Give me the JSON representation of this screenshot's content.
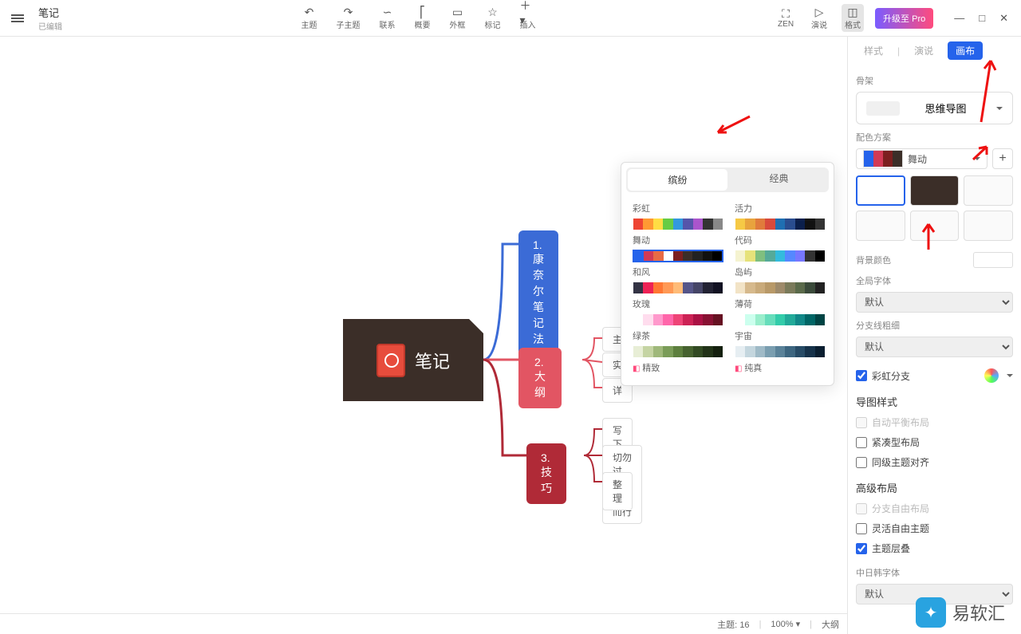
{
  "header": {
    "title": "笔记",
    "subtitle": "已编辑",
    "toolbar": [
      {
        "label": "主题",
        "icon": "↶"
      },
      {
        "label": "子主题",
        "icon": "↷"
      },
      {
        "label": "联系",
        "icon": "∽"
      },
      {
        "label": "概要",
        "icon": "⎡"
      },
      {
        "label": "外框",
        "icon": "▭"
      },
      {
        "label": "标记",
        "icon": "☆"
      },
      {
        "label": "插入",
        "icon": "＋"
      }
    ],
    "right_tools": [
      {
        "label": "ZEN",
        "icon": "⛶"
      },
      {
        "label": "演说",
        "icon": "▷"
      },
      {
        "label": "格式",
        "icon": "◫",
        "active": true
      }
    ],
    "pro_button": "升级至 Pro"
  },
  "mindmap": {
    "central": "笔记",
    "branches": [
      {
        "label": "1. 康奈尔笔记法",
        "children": []
      },
      {
        "label": "2. 大纲",
        "children": [
          "主",
          "实",
          "详"
        ]
      },
      {
        "label": "3. 技巧",
        "children": [
          "写下关键事实",
          "切勿过度，量力而行",
          "整理"
        ]
      }
    ]
  },
  "theme_popup": {
    "tabs": [
      "缤纷",
      "经典"
    ],
    "active_tab": 0,
    "schemes": [
      {
        "name": "彩虹",
        "colors": [
          "#e43",
          "#f93",
          "#fd4",
          "#6c4",
          "#39d",
          "#55a",
          "#a5c",
          "#333",
          "#888"
        ]
      },
      {
        "name": "活力",
        "colors": [
          "#f6c945",
          "#e8a33d",
          "#e07b3c",
          "#d84a3c",
          "#1f6fb2",
          "#2a4d8f",
          "#0b1f4b",
          "#111",
          "#333"
        ]
      },
      {
        "name": "舞动",
        "colors": [
          "#2563eb",
          "#d23a55",
          "#e86b45",
          "#fff",
          "#7c1f1f",
          "#3b2e28",
          "#222",
          "#111",
          "#000"
        ],
        "selected": true
      },
      {
        "name": "代码",
        "colors": [
          "#f5f3d0",
          "#e6e27a",
          "#7fbf7f",
          "#5a9",
          "#3bd",
          "#58f",
          "#77f",
          "#333",
          "#000"
        ]
      },
      {
        "name": "和风",
        "colors": [
          "#334",
          "#e25",
          "#f73",
          "#f95",
          "#fb7",
          "#558",
          "#446",
          "#223",
          "#112"
        ]
      },
      {
        "name": "岛屿",
        "colors": [
          "#f2e3c6",
          "#d6b98c",
          "#c9aa7a",
          "#b89968",
          "#9e8a6a",
          "#7a7a5a",
          "#5a6a4a",
          "#3a4a3a",
          "#222"
        ]
      },
      {
        "name": "玫瑰",
        "colors": [
          "#fff",
          "#fde",
          "#f9c",
          "#f6a",
          "#e47",
          "#c25",
          "#a14",
          "#813",
          "#612"
        ]
      },
      {
        "name": "薄荷",
        "colors": [
          "#fff",
          "#cfe",
          "#9ec",
          "#6db",
          "#3ca",
          "#2a9",
          "#188",
          "#066",
          "#044"
        ]
      },
      {
        "name": "绿茶",
        "colors": [
          "#e8eed6",
          "#c5d4a3",
          "#9fb87a",
          "#7a9c58",
          "#5d7f3e",
          "#46622f",
          "#324a23",
          "#223318",
          "#14200e"
        ]
      },
      {
        "name": "宇宙",
        "colors": [
          "#e6eef2",
          "#c4d6de",
          "#9fbac7",
          "#7a9eb0",
          "#5a8299",
          "#3d6680",
          "#274b66",
          "#16324a",
          "#0a1e30"
        ]
      },
      {
        "name": "精致",
        "pro": true
      },
      {
        "name": "纯真",
        "pro": true
      }
    ]
  },
  "side_panel": {
    "tabs": [
      "样式",
      "演说",
      "画布"
    ],
    "active_tab": 2,
    "skeleton_label": "骨架",
    "structure": "思维导图",
    "scheme_label": "配色方案",
    "selected_scheme": "舞动",
    "scheme_colors": [
      "#2563eb",
      "#d23a55",
      "#7c1f1f",
      "#3b2e28"
    ],
    "bg_label": "背景颜色",
    "global_font_label": "全局字体",
    "global_font": "默认",
    "branch_width_label": "分支线粗细",
    "branch_width": "默认",
    "rainbow_branch_label": "彩虹分支",
    "rainbow_checked": true,
    "map_style_label": "导图样式",
    "auto_balance": "自动平衡布局",
    "compact": "紧凑型布局",
    "align_siblings": "同级主题对齐",
    "advanced_label": "高级布局",
    "free_branch": "分支自由布局",
    "free_topic": "灵活自由主题",
    "topic_overlap": "主题层叠",
    "cjk_font_label": "中日韩字体",
    "cjk_font": "默认"
  },
  "status_bar": {
    "topics_label": "主题:",
    "topics_count": 16,
    "zoom": "100%",
    "outline": "大纲"
  },
  "watermark": "易软汇"
}
